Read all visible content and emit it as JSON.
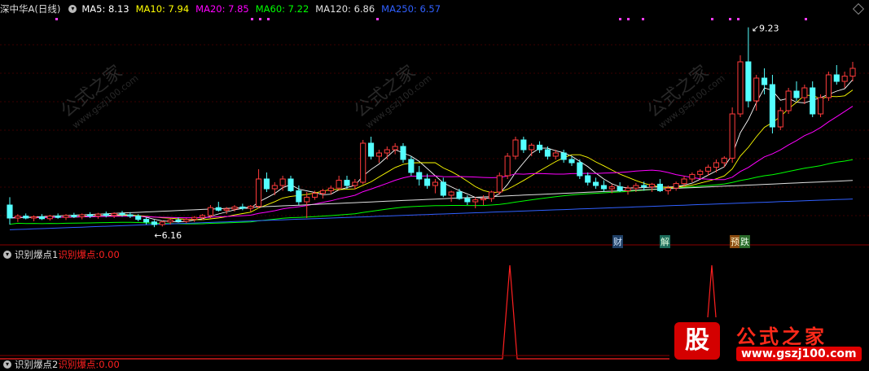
{
  "legend": {
    "stock_name": "深中华A",
    "period": "(日线)",
    "items": [
      {
        "label": "MA5:",
        "value": "8.13",
        "color": "#ffffff"
      },
      {
        "label": "MA10:",
        "value": "7.94",
        "color": "#ffff00"
      },
      {
        "label": "MA20:",
        "value": "7.85",
        "color": "#ff00ff"
      },
      {
        "label": "MA60:",
        "value": "7.22",
        "color": "#00ff00"
      },
      {
        "label": "MA120:",
        "value": "6.86",
        "color": "#e0e0e0"
      },
      {
        "label": "MA250:",
        "value": "6.57",
        "color": "#3060ff"
      }
    ]
  },
  "indicator1": {
    "name": "识别爆点1",
    "label": "识别爆点:",
    "value": "0.00",
    "color": "#ff2020"
  },
  "indicator2": {
    "name": "识别爆点2",
    "label": "识别爆点:",
    "value": "0.00",
    "color": "#ff2020"
  },
  "watermark": {
    "text": "公式之家",
    "url": "www.gszj100.com"
  },
  "brand": {
    "logo": "股",
    "name": "公式之家",
    "url": "www.gszj100.com"
  },
  "events": [
    {
      "text": "财",
      "color": "#cfe6ff",
      "bg": "#1f3f66"
    },
    {
      "text": "解",
      "color": "#dfffdf",
      "bg": "#1b6b5a"
    },
    {
      "text": "预",
      "color": "#fff5cc",
      "bg": "#8a4b10"
    },
    {
      "text": "跌",
      "color": "#eaffea",
      "bg": "#2a6a2a"
    }
  ],
  "chart_data": [
    {
      "type": "candlestick",
      "title": "",
      "annotations": [
        {
          "text": "6.16",
          "kind": "low"
        },
        {
          "text": "9.23",
          "kind": "high"
        }
      ],
      "ylim": [
        5.9,
        9.4
      ],
      "colors": {
        "up": "#ff3b3b",
        "down": "#54ffff",
        "ma5": "#ffffff",
        "ma10": "#ffff00",
        "ma20": "#ff00ff",
        "ma60": "#00ff00",
        "ma120": "#e0e0e0",
        "ma250": "#3060ff"
      },
      "candles": [
        [
          6.5,
          6.62,
          6.2,
          6.3
        ],
        [
          6.3,
          6.36,
          6.24,
          6.33
        ],
        [
          6.33,
          6.37,
          6.28,
          6.3
        ],
        [
          6.3,
          6.34,
          6.25,
          6.32
        ],
        [
          6.32,
          6.36,
          6.27,
          6.29
        ],
        [
          6.29,
          6.35,
          6.26,
          6.33
        ],
        [
          6.33,
          6.37,
          6.29,
          6.31
        ],
        [
          6.31,
          6.36,
          6.27,
          6.34
        ],
        [
          6.34,
          6.38,
          6.3,
          6.32
        ],
        [
          6.32,
          6.37,
          6.28,
          6.35
        ],
        [
          6.35,
          6.39,
          6.3,
          6.33
        ],
        [
          6.33,
          6.38,
          6.29,
          6.36
        ],
        [
          6.36,
          6.4,
          6.31,
          6.34
        ],
        [
          6.34,
          6.39,
          6.3,
          6.37
        ],
        [
          6.37,
          6.41,
          6.32,
          6.35
        ],
        [
          6.35,
          6.39,
          6.3,
          6.33
        ],
        [
          6.33,
          6.36,
          6.25,
          6.28
        ],
        [
          6.28,
          6.31,
          6.2,
          6.24
        ],
        [
          6.24,
          6.27,
          6.16,
          6.2
        ],
        [
          6.2,
          6.26,
          6.17,
          6.24
        ],
        [
          6.24,
          6.29,
          6.2,
          6.27
        ],
        [
          6.27,
          6.31,
          6.23,
          6.25
        ],
        [
          6.25,
          6.3,
          6.22,
          6.28
        ],
        [
          6.28,
          6.33,
          6.24,
          6.31
        ],
        [
          6.31,
          6.36,
          6.27,
          6.34
        ],
        [
          6.34,
          6.5,
          6.3,
          6.46
        ],
        [
          6.46,
          6.55,
          6.4,
          6.42
        ],
        [
          6.42,
          6.47,
          6.36,
          6.44
        ],
        [
          6.44,
          6.5,
          6.4,
          6.47
        ],
        [
          6.47,
          6.52,
          6.42,
          6.45
        ],
        [
          6.45,
          6.5,
          6.4,
          6.48
        ],
        [
          6.48,
          7.05,
          6.45,
          6.9
        ],
        [
          6.9,
          7.0,
          6.7,
          6.75
        ],
        [
          6.75,
          6.85,
          6.65,
          6.8
        ],
        [
          6.8,
          6.95,
          6.72,
          6.9
        ],
        [
          6.9,
          6.95,
          6.7,
          6.72
        ],
        [
          6.72,
          6.8,
          6.5,
          6.55
        ],
        [
          6.55,
          6.7,
          6.3,
          6.62
        ],
        [
          6.62,
          6.72,
          6.58,
          6.68
        ],
        [
          6.68,
          6.75,
          6.6,
          6.72
        ],
        [
          6.72,
          6.8,
          6.66,
          6.76
        ],
        [
          6.76,
          6.95,
          6.72,
          6.88
        ],
        [
          6.88,
          6.95,
          6.75,
          6.8
        ],
        [
          6.8,
          6.9,
          6.74,
          6.85
        ],
        [
          6.85,
          7.5,
          6.82,
          7.45
        ],
        [
          7.45,
          7.55,
          7.2,
          7.25
        ],
        [
          7.25,
          7.35,
          7.15,
          7.3
        ],
        [
          7.3,
          7.4,
          7.2,
          7.35
        ],
        [
          7.35,
          7.45,
          7.28,
          7.4
        ],
        [
          7.4,
          7.45,
          7.15,
          7.2
        ],
        [
          7.2,
          7.25,
          6.95,
          7.0
        ],
        [
          7.0,
          7.1,
          6.8,
          6.9
        ],
        [
          6.9,
          6.98,
          6.75,
          6.8
        ],
        [
          6.8,
          6.9,
          6.68,
          6.85
        ],
        [
          6.85,
          6.92,
          6.62,
          6.65
        ],
        [
          6.65,
          6.72,
          6.55,
          6.7
        ],
        [
          6.7,
          6.75,
          6.58,
          6.6
        ],
        [
          6.6,
          6.65,
          6.5,
          6.55
        ],
        [
          6.55,
          6.62,
          6.45,
          6.58
        ],
        [
          6.58,
          6.65,
          6.5,
          6.6
        ],
        [
          6.6,
          6.72,
          6.55,
          6.7
        ],
        [
          6.7,
          7.0,
          6.66,
          6.95
        ],
        [
          6.95,
          7.3,
          6.9,
          7.25
        ],
        [
          7.25,
          7.55,
          7.2,
          7.5
        ],
        [
          7.5,
          7.55,
          7.3,
          7.35
        ],
        [
          7.35,
          7.45,
          7.25,
          7.42
        ],
        [
          7.42,
          7.48,
          7.3,
          7.35
        ],
        [
          7.35,
          7.4,
          7.2,
          7.25
        ],
        [
          7.25,
          7.35,
          7.2,
          7.3
        ],
        [
          7.3,
          7.35,
          7.15,
          7.2
        ],
        [
          7.2,
          7.25,
          7.1,
          7.15
        ],
        [
          7.15,
          7.2,
          6.9,
          6.95
        ],
        [
          6.95,
          7.0,
          6.8,
          6.85
        ],
        [
          6.85,
          6.92,
          6.75,
          6.8
        ],
        [
          6.8,
          6.88,
          6.7,
          6.75
        ],
        [
          6.75,
          6.82,
          6.68,
          6.78
        ],
        [
          6.78,
          6.85,
          6.7,
          6.72
        ],
        [
          6.72,
          6.8,
          6.66,
          6.76
        ],
        [
          6.76,
          6.84,
          6.7,
          6.8
        ],
        [
          6.8,
          6.86,
          6.72,
          6.78
        ],
        [
          6.78,
          6.84,
          6.7,
          6.82
        ],
        [
          6.82,
          6.9,
          6.7,
          6.72
        ],
        [
          6.72,
          6.8,
          6.66,
          6.76
        ],
        [
          6.76,
          6.86,
          6.72,
          6.83
        ],
        [
          6.83,
          6.95,
          6.78,
          6.9
        ],
        [
          6.9,
          7.0,
          6.85,
          6.97
        ],
        [
          6.97,
          7.05,
          6.9,
          7.02
        ],
        [
          7.02,
          7.12,
          6.95,
          7.08
        ],
        [
          7.08,
          7.2,
          7.0,
          7.15
        ],
        [
          7.15,
          7.25,
          7.08,
          7.22
        ],
        [
          7.22,
          8.0,
          7.15,
          7.9
        ],
        [
          7.9,
          8.8,
          7.85,
          8.7
        ],
        [
          8.7,
          9.23,
          8.0,
          8.1
        ],
        [
          8.1,
          8.5,
          7.95,
          8.45
        ],
        [
          8.45,
          8.6,
          8.2,
          8.35
        ],
        [
          8.35,
          8.5,
          7.6,
          7.7
        ],
        [
          7.7,
          8.0,
          7.65,
          7.95
        ],
        [
          7.95,
          8.3,
          7.9,
          8.25
        ],
        [
          8.25,
          8.4,
          8.1,
          8.15
        ],
        [
          8.15,
          8.35,
          8.05,
          8.3
        ],
        [
          8.3,
          8.4,
          7.85,
          7.9
        ],
        [
          7.9,
          8.2,
          7.85,
          8.15
        ],
        [
          8.15,
          8.55,
          8.1,
          8.5
        ],
        [
          8.5,
          8.65,
          8.35,
          8.4
        ],
        [
          8.4,
          8.55,
          8.3,
          8.48
        ],
        [
          8.48,
          8.7,
          8.4,
          8.6
        ]
      ]
    },
    {
      "type": "line",
      "series": [
        {
          "name": "识别爆点",
          "color": "#ff2020"
        }
      ],
      "ylim": [
        0,
        1
      ],
      "spikes_at_index": [
        80,
        94
      ]
    }
  ]
}
